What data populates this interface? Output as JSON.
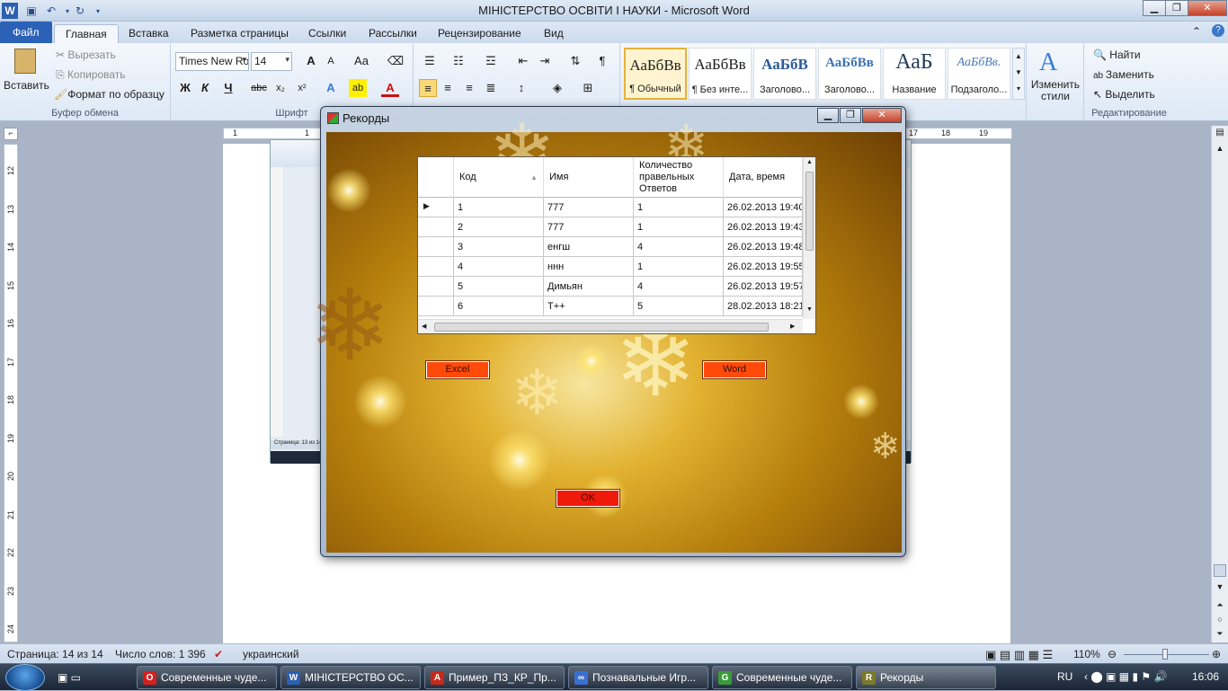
{
  "window": {
    "title": "МІНІСТЕРСТВО ОСВІТИ І НАУКИ  -  Microsoft Word"
  },
  "tabs": [
    {
      "label": "Файл"
    },
    {
      "label": "Главная"
    },
    {
      "label": "Вставка"
    },
    {
      "label": "Разметка страницы"
    },
    {
      "label": "Ссылки"
    },
    {
      "label": "Рассылки"
    },
    {
      "label": "Рецензирование"
    },
    {
      "label": "Вид"
    }
  ],
  "ribbon": {
    "clipboard": {
      "label": "Буфер обмена",
      "paste": "Вставить",
      "cut": "Вырезать",
      "copy": "Копировать",
      "format_painter": "Формат по образцу"
    },
    "font": {
      "label": "Шрифт",
      "name": "Times New Ro",
      "size": "14"
    },
    "styles": [
      {
        "sample": "АаБбВв",
        "name": "¶ Обычный"
      },
      {
        "sample": "АаБбВв",
        "name": "¶ Без инте..."
      },
      {
        "sample": "АаБбВ",
        "name": "Заголово..."
      },
      {
        "sample": "АаБбВв",
        "name": "Заголово..."
      },
      {
        "sample": "АаБ",
        "name": "Название"
      },
      {
        "sample": "АаБбВв.",
        "name": "Подзаголо..."
      }
    ],
    "change_styles": "Изменить стили",
    "editing": {
      "label": "Редактирование",
      "find": "Найти",
      "replace": "Заменить",
      "select": "Выделить"
    }
  },
  "ruler_numbers": [
    "1",
    "1",
    "17",
    "18",
    "19"
  ],
  "vruler_numbers": [
    "12",
    "13",
    "14",
    "15",
    "16",
    "17",
    "18",
    "19",
    "20",
    "21",
    "22",
    "23",
    "24"
  ],
  "statusbar": {
    "page": "Страница: 14 из 14",
    "words": "Число слов: 1 396",
    "language": "украинский",
    "zoom": "110%"
  },
  "taskbar": {
    "items": [
      {
        "label": "Современные чуде...",
        "color": "#d42020",
        "glyph": "O"
      },
      {
        "label": "МІНІСТЕРСТВО ОС...",
        "color": "#2b5fb0",
        "glyph": "W"
      },
      {
        "label": "Пример_ПЗ_КР_Пр...",
        "color": "#c42b1c",
        "glyph": "A"
      },
      {
        "label": "Познавальные Игр...",
        "color": "#3b6fd1",
        "glyph": "∞"
      },
      {
        "label": "Современные чуде...",
        "color": "#3a9a3a",
        "glyph": "G"
      },
      {
        "label": "Рекорды",
        "color": "#7a7a2a",
        "glyph": "R"
      }
    ],
    "lang": "RU",
    "clock": "16:06"
  },
  "dialog": {
    "title": "Рекорды",
    "columns": [
      "Код",
      "Имя",
      "Количество правельных Ответов",
      "Дата, время"
    ],
    "rows": [
      [
        "1",
        "777",
        "1",
        "26.02.2013 19:40"
      ],
      [
        "2",
        "777",
        "1",
        "26.02.2013 19:43"
      ],
      [
        "3",
        "енгш",
        "4",
        "26.02.2013 19:48"
      ],
      [
        "4",
        "ннн",
        "1",
        "26.02.2013 19:55"
      ],
      [
        "5",
        "Димьян",
        "4",
        "26.02.2013 19:57"
      ],
      [
        "6",
        "Т++",
        "5",
        "28.02.2013 18:21"
      ]
    ],
    "buttons": {
      "excel": "Excel",
      "word": "Word",
      "ok": "OK"
    },
    "accent": "#ff4a0a"
  },
  "inner_status": "Страница: 13 из 14"
}
